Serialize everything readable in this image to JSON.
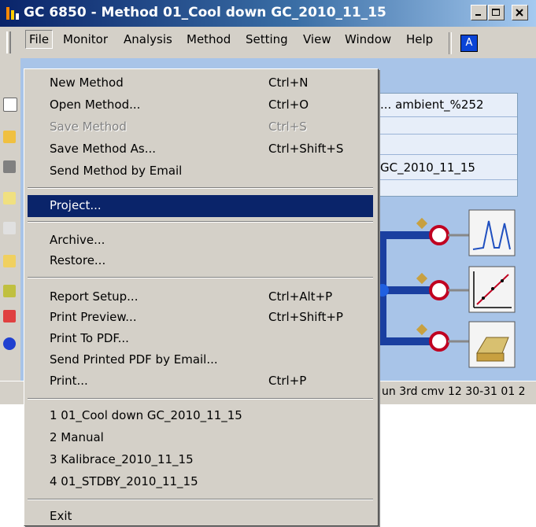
{
  "window": {
    "title": "GC 6850 - Method  01_Cool down GC_2010_11_15"
  },
  "menubar": {
    "items": [
      "File",
      "Monitor",
      "Analysis",
      "Method",
      "Setting",
      "View",
      "Window",
      "Help"
    ],
    "help_icon_glyph": "A"
  },
  "panel": {
    "rows": [
      "... ambient_%252",
      "",
      "",
      "GC_2010_11_15",
      ""
    ]
  },
  "status_bar": {
    "text": "un 3rd cmv 12 30-31 01 2"
  },
  "file_menu": {
    "items": [
      {
        "label": "New Method",
        "shortcut": "Ctrl+N"
      },
      {
        "label": "Open Method...",
        "shortcut": "Ctrl+O"
      },
      {
        "label": "Save Method",
        "shortcut": "Ctrl+S",
        "disabled": true
      },
      {
        "label": "Save Method As...",
        "shortcut": "Ctrl+Shift+S"
      },
      {
        "label": "Send Method by Email",
        "shortcut": ""
      },
      {
        "label": "Project...",
        "shortcut": "",
        "selected": true
      },
      {
        "label": "Archive...",
        "shortcut": ""
      },
      {
        "label": "Restore...",
        "shortcut": ""
      },
      {
        "label": "Report Setup...",
        "shortcut": "Ctrl+Alt+P"
      },
      {
        "label": "Print Preview...",
        "shortcut": "Ctrl+Shift+P"
      },
      {
        "label": "Print To PDF...",
        "shortcut": ""
      },
      {
        "label": "Send Printed PDF by Email...",
        "shortcut": ""
      },
      {
        "label": "Print...",
        "shortcut": "Ctrl+P"
      },
      {
        "label": "1 01_Cool down GC_2010_11_15",
        "shortcut": ""
      },
      {
        "label": "2 Manual",
        "shortcut": ""
      },
      {
        "label": "3 Kalibrace_2010_11_15",
        "shortcut": ""
      },
      {
        "label": "4 01_STDBY_2010_11_15",
        "shortcut": ""
      },
      {
        "label": "Exit",
        "shortcut": ""
      }
    ]
  },
  "colors": {
    "title_gradient_start": "#0a246a",
    "menu_highlight": "#0a246a",
    "window_face": "#d4d0c8",
    "content_bg": "#a8c4e8"
  }
}
